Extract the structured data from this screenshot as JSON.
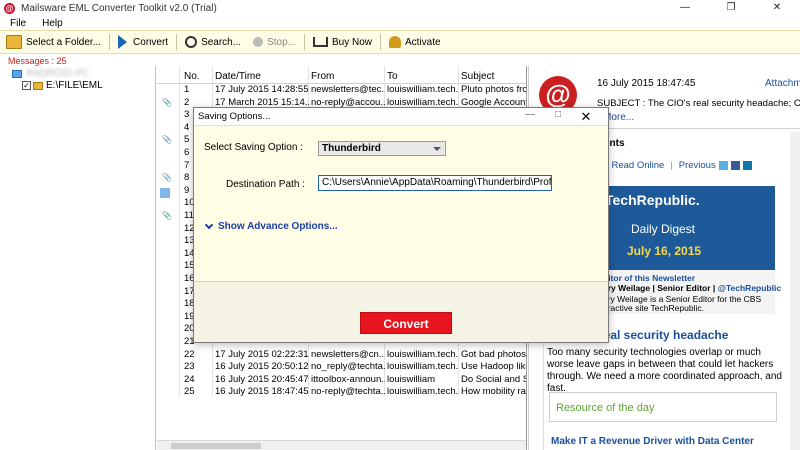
{
  "window": {
    "title": "Mailsware EML Converter Toolkit v2.0 (Trial)",
    "app_icon_glyph": "@",
    "minimize": "—",
    "maximize": "❐",
    "close": "✕"
  },
  "menu": {
    "file": "File",
    "help": "Help"
  },
  "toolbar": {
    "select_folder": "Select a Folder...",
    "convert": "Convert",
    "search": "Search...",
    "stop": "Stop...",
    "buy_now": "Buy Now",
    "activate": "Activate"
  },
  "messages_count": "Messages : 25",
  "tree": {
    "root_label": "ANDROID-PC",
    "folder_label": "E:\\FILE\\EML",
    "checkbox_mark": "✓"
  },
  "grid": {
    "headers": {
      "no": "No.",
      "date": "Date/Time",
      "from": "From",
      "to": "To",
      "subject": "Subject"
    },
    "attachment_glyph": "📎",
    "rows": [
      {
        "no": "1",
        "date": "17 July 2015 14:28:55",
        "from": "newsletters@tec...",
        "to": "louiswilliam.tech...",
        "subject": "Pluto photos from",
        "att": false
      },
      {
        "no": "2",
        "date": "17 March 2015 15:14...",
        "from": "no-reply@accou...",
        "to": "louiswilliam.tech...",
        "subject": "Google Account: s",
        "att": true
      },
      {
        "no": "3",
        "date": "",
        "from": "",
        "to": "",
        "subject": "",
        "att": false
      },
      {
        "no": "4",
        "date": "",
        "from": "",
        "to": "",
        "subject": "",
        "att": false
      },
      {
        "no": "5",
        "date": "",
        "from": "",
        "to": "",
        "subject": "",
        "att": true
      },
      {
        "no": "6",
        "date": "",
        "from": "",
        "to": "",
        "subject": "",
        "att": false
      },
      {
        "no": "7",
        "date": "",
        "from": "",
        "to": "",
        "subject": "",
        "att": false
      },
      {
        "no": "8",
        "date": "",
        "from": "",
        "to": "",
        "subject": "",
        "att": true
      },
      {
        "no": "9",
        "date": "",
        "from": "",
        "to": "",
        "subject": "",
        "att": false
      },
      {
        "no": "10",
        "date": "",
        "from": "",
        "to": "",
        "subject": "",
        "att": false
      },
      {
        "no": "11",
        "date": "",
        "from": "",
        "to": "",
        "subject": "",
        "att": true
      },
      {
        "no": "12",
        "date": "",
        "from": "",
        "to": "",
        "subject": "",
        "att": false
      },
      {
        "no": "13",
        "date": "",
        "from": "",
        "to": "",
        "subject": "",
        "att": false
      },
      {
        "no": "14",
        "date": "",
        "from": "",
        "to": "",
        "subject": "",
        "att": false
      },
      {
        "no": "15",
        "date": "",
        "from": "",
        "to": "",
        "subject": "",
        "att": false
      },
      {
        "no": "16",
        "date": "",
        "from": "",
        "to": "",
        "subject": "",
        "att": false
      },
      {
        "no": "17",
        "date": "",
        "from": "",
        "to": "",
        "subject": "",
        "att": false
      },
      {
        "no": "18",
        "date": "",
        "from": "",
        "to": "",
        "subject": "",
        "att": false
      },
      {
        "no": "19",
        "date": "",
        "from": "",
        "to": "",
        "subject": "",
        "att": false
      },
      {
        "no": "20",
        "date": "",
        "from": "",
        "to": "",
        "subject": "",
        "att": false
      },
      {
        "no": "21",
        "date": "",
        "from": "",
        "to": "",
        "subject": "",
        "att": false
      },
      {
        "no": "22",
        "date": "17 July 2015 02:22:31",
        "from": "newsletters@cn...",
        "to": "louiswilliam.tech...",
        "subject": "Got bad photos? H",
        "att": false
      },
      {
        "no": "23",
        "date": "16 July 2015 20:50:12",
        "from": "no_reply@techta...",
        "to": "louiswilliam.tech...",
        "subject": "Use Hadoop like yo",
        "att": false
      },
      {
        "no": "24",
        "date": "16 July 2015 20:45:47",
        "from": "ittoolbox-announ...",
        "to": "louiswilliam",
        "subject": "Do Social and Sea",
        "att": false
      },
      {
        "no": "25",
        "date": "16 July 2015 18:47:45",
        "from": "no-reply@techta...",
        "to": "louiswilliam.tech...",
        "subject": "How mobility raise",
        "att": false
      }
    ]
  },
  "preview": {
    "date": "16 July 2015 18:47:45",
    "attachments_link": "Attachme",
    "subject": "SUBJECT : The CIO's real security headache; Can Mi",
    "more": "More...",
    "attachments_heading": "hments",
    "links": {
      "read_online": "Read Online",
      "previous": "Previous"
    },
    "banner": {
      "logo": "TechRepublic.",
      "digest": "Daily Digest",
      "date": "July 16, 2015"
    },
    "editor": {
      "line1": "ditor of this Newsletter",
      "name": "ary Weilage | Senior Editor |",
      "handle": "@TechRepublic",
      "line3": "ary Weilage is a Senior Editor for the CBS",
      "line4": "eractive site TechRepublic."
    },
    "headline": "real security headache",
    "paragraph": "Too many security technologies overlap or much worse leave gaps in between that could let hackers through. We need a more coordinated approach, and fast.",
    "resource": "Resource of the day",
    "link2": "Make IT a Revenue Driver with Data Center"
  },
  "dialog": {
    "title": "Saving Options...",
    "minimize": "—",
    "maximize": "□",
    "close": "✕",
    "select_label": "Select Saving Option :",
    "select_value": "Thunderbird",
    "dest_label": "Destination Path :",
    "dest_value": "C:\\Users\\Annie\\AppData\\Roaming\\Thunderbird\\Profiles\\",
    "advance": "Show Advance Options...",
    "convert": "Convert"
  },
  "colors": {
    "accent_red": "#e8141e",
    "toolbar_bg": "#fffde6",
    "link_blue": "#1a4f9c"
  }
}
